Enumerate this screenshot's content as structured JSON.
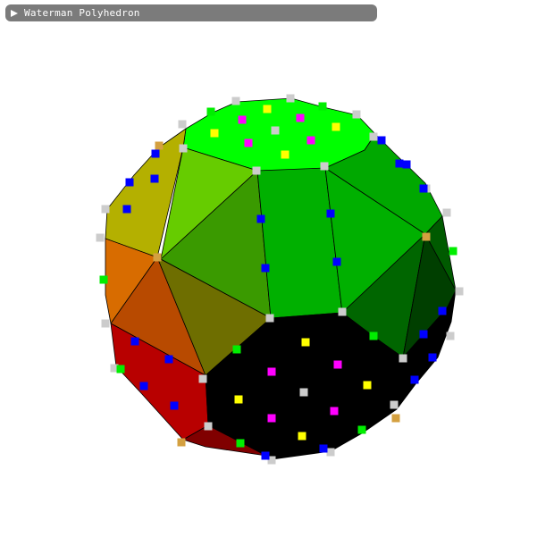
{
  "header": {
    "title": "Waterman Polyhedron",
    "icon": "collapse-arrow-right-icon",
    "background": "#7b7b7b",
    "text_color": "#ffffff"
  },
  "scene": {
    "background": "#ffffff",
    "face_palette": [
      "#00ff00",
      "#66cc00",
      "#00b000",
      "#009900",
      "#3a9a00",
      "#006600",
      "#003f00",
      "#b4b000",
      "#d86c00",
      "#b84a00",
      "#6e6e00",
      "#b80000",
      "#800000",
      "#000000"
    ],
    "vertex_marker_palette": [
      "#cccccc",
      "#d4a040",
      "#0000ff",
      "#00ee00",
      "#ff00ff",
      "#ffff00"
    ]
  }
}
